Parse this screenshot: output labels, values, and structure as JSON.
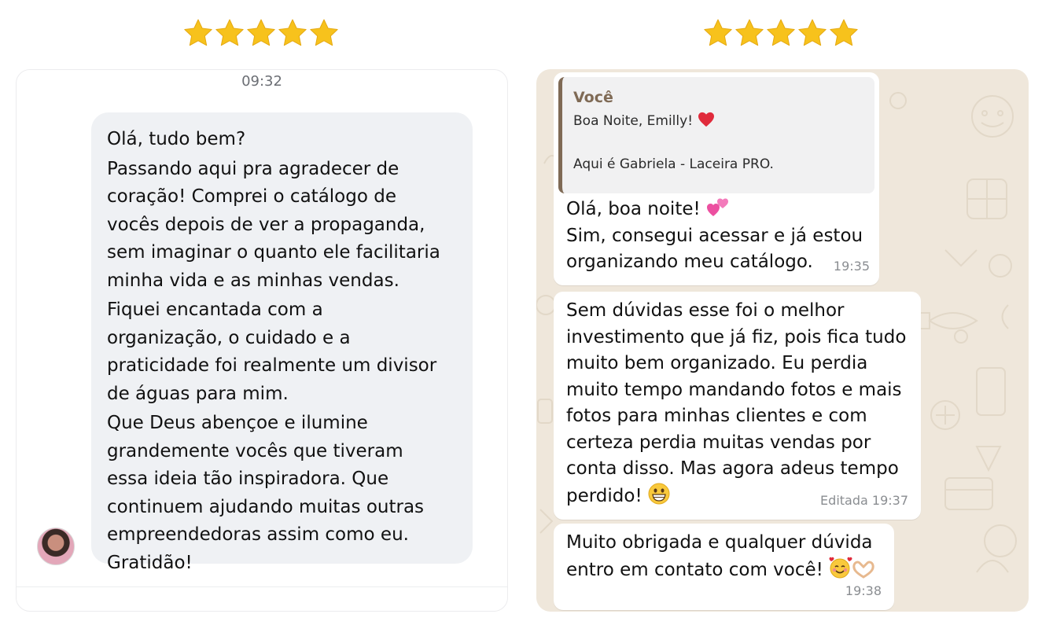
{
  "left_review": {
    "rating": 5,
    "time": "09:32",
    "message_lines": [
      "Olá, tudo bem?",
      "Passando aqui pra agradecer de",
      "coração! Comprei o catálogo de",
      "vocês depois de ver a propaganda,",
      "sem imaginar o quanto ele facilitaria",
      "minha vida e as minhas vendas.",
      "Fiquei encantada com a",
      "organização, o cuidado e a",
      "praticidade foi realmente um divisor",
      "de águas para mim.",
      "Que Deus abençoe e ilumine",
      "grandemente vocês que tiveram",
      "essa ideia tão inspiradora. Que",
      "continuem ajudando muitas outras",
      "empreendedoras assim como eu.",
      "Gratidão!"
    ]
  },
  "right_review": {
    "rating": 5,
    "quote": {
      "author": "Você",
      "line1": "Boa Noite, Emilly!",
      "line2": "Aqui é Gabriela - Laceira PRO."
    },
    "msg1": {
      "line1": "Olá, boa noite!",
      "line2": "Sim, consegui acessar e já estou",
      "line3": "organizando meu catálogo.",
      "time": "19:35"
    },
    "msg2": {
      "lines": [
        "Sem dúvidas esse foi o melhor",
        "investimento que já fiz, pois fica tudo",
        "muito bem organizado. Eu perdia",
        "muito tempo mandando fotos e mais",
        "fotos para minhas clientes e com",
        "certeza perdia muitas vendas por",
        "conta disso. Mas agora adeus tempo"
      ],
      "last_line": "perdido!",
      "time": "Editada 19:37"
    },
    "msg3": {
      "line1": "Muito obrigada e qualquer dúvida",
      "line2": "entro em contato com você!",
      "time": "19:38"
    }
  },
  "colors": {
    "star": "#f7c21c",
    "quote_accent": "#7f6a55",
    "wallpaper": "#efe7db",
    "ig_bubble": "#eff1f4"
  }
}
